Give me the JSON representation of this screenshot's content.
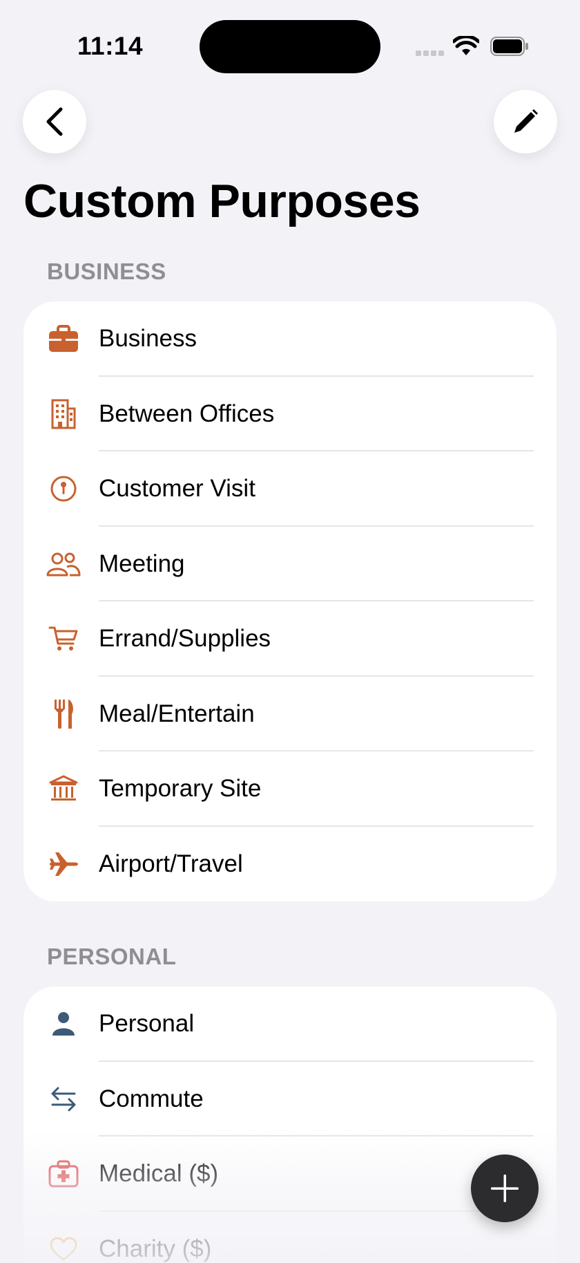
{
  "status_bar": {
    "time": "11:14"
  },
  "page": {
    "title": "Custom Purposes"
  },
  "colors": {
    "business_accent": "#c8612e",
    "personal_accent": "#3d5a7a"
  },
  "sections": [
    {
      "header": "BUSINESS",
      "items": [
        {
          "label": "Business",
          "icon": "briefcase-icon"
        },
        {
          "label": "Between Offices",
          "icon": "building-icon"
        },
        {
          "label": "Customer Visit",
          "icon": "location-pin-icon"
        },
        {
          "label": "Meeting",
          "icon": "people-icon"
        },
        {
          "label": "Errand/Supplies",
          "icon": "cart-icon"
        },
        {
          "label": "Meal/Entertain",
          "icon": "fork-knife-icon"
        },
        {
          "label": "Temporary Site",
          "icon": "institution-icon"
        },
        {
          "label": "Airport/Travel",
          "icon": "airplane-icon"
        }
      ]
    },
    {
      "header": "PERSONAL",
      "items": [
        {
          "label": "Personal",
          "icon": "person-icon"
        },
        {
          "label": "Commute",
          "icon": "arrows-swap-icon"
        },
        {
          "label": "Medical ($)",
          "icon": "medical-kit-icon"
        },
        {
          "label": "Charity ($)",
          "icon": "heart-icon"
        }
      ]
    }
  ]
}
